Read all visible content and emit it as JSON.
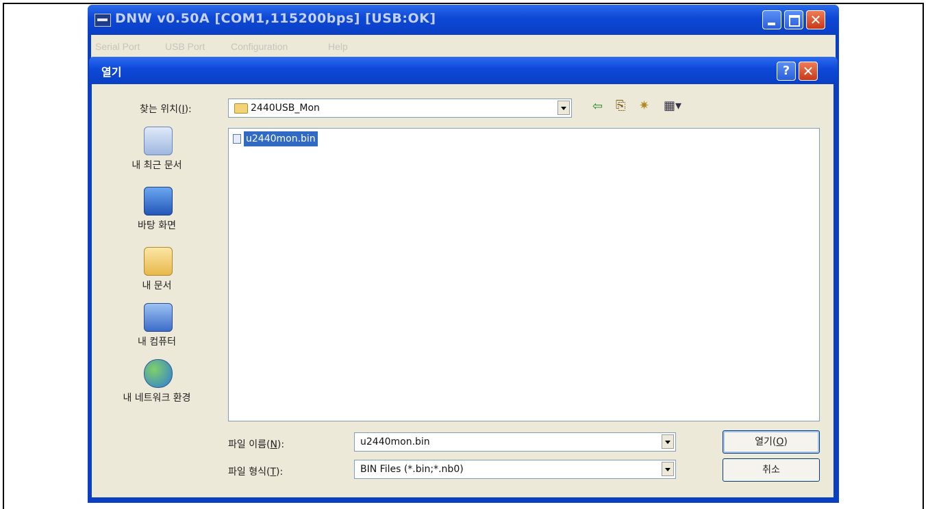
{
  "app": {
    "title": "DNW v0.50A   [COM1,115200bps] [USB:OK]",
    "menu": [
      "Serial Port",
      "USB Port",
      "Configuration",
      "Help"
    ]
  },
  "dialog": {
    "title": "열기",
    "help_glyph": "?",
    "close_glyph": "✕",
    "look_in_label": "찾는 위치(",
    "look_in_key": "I",
    "look_in_suffix": "):",
    "look_in_value": "2440USB_Mon",
    "places": [
      {
        "label": "내 최근 문서",
        "icon": "recent-documents-icon"
      },
      {
        "label": "바탕 화면",
        "icon": "desktop-icon"
      },
      {
        "label": "내 문서",
        "icon": "my-documents-icon"
      },
      {
        "label": "내 컴퓨터",
        "icon": "my-computer-icon"
      },
      {
        "label": "내 네트워크 환경",
        "icon": "network-places-icon"
      }
    ],
    "files": [
      {
        "name": "u2440mon.bin",
        "selected": true
      }
    ],
    "filename_label": "파일 이름(",
    "filename_key": "N",
    "filename_suffix": "):",
    "filename_value": "u2440mon.bin",
    "filetype_label": "파일 형식(",
    "filetype_key": "T",
    "filetype_suffix": "):",
    "filetype_value": "BIN Files (*.bin;*.nb0)",
    "open_label": "열기(",
    "open_key": "O",
    "open_suffix": ")",
    "cancel_label": "취소"
  },
  "colors": {
    "title_blue": "#0a3fc4",
    "selection": "#316ac5",
    "dialog_face": "#ece9d8"
  }
}
